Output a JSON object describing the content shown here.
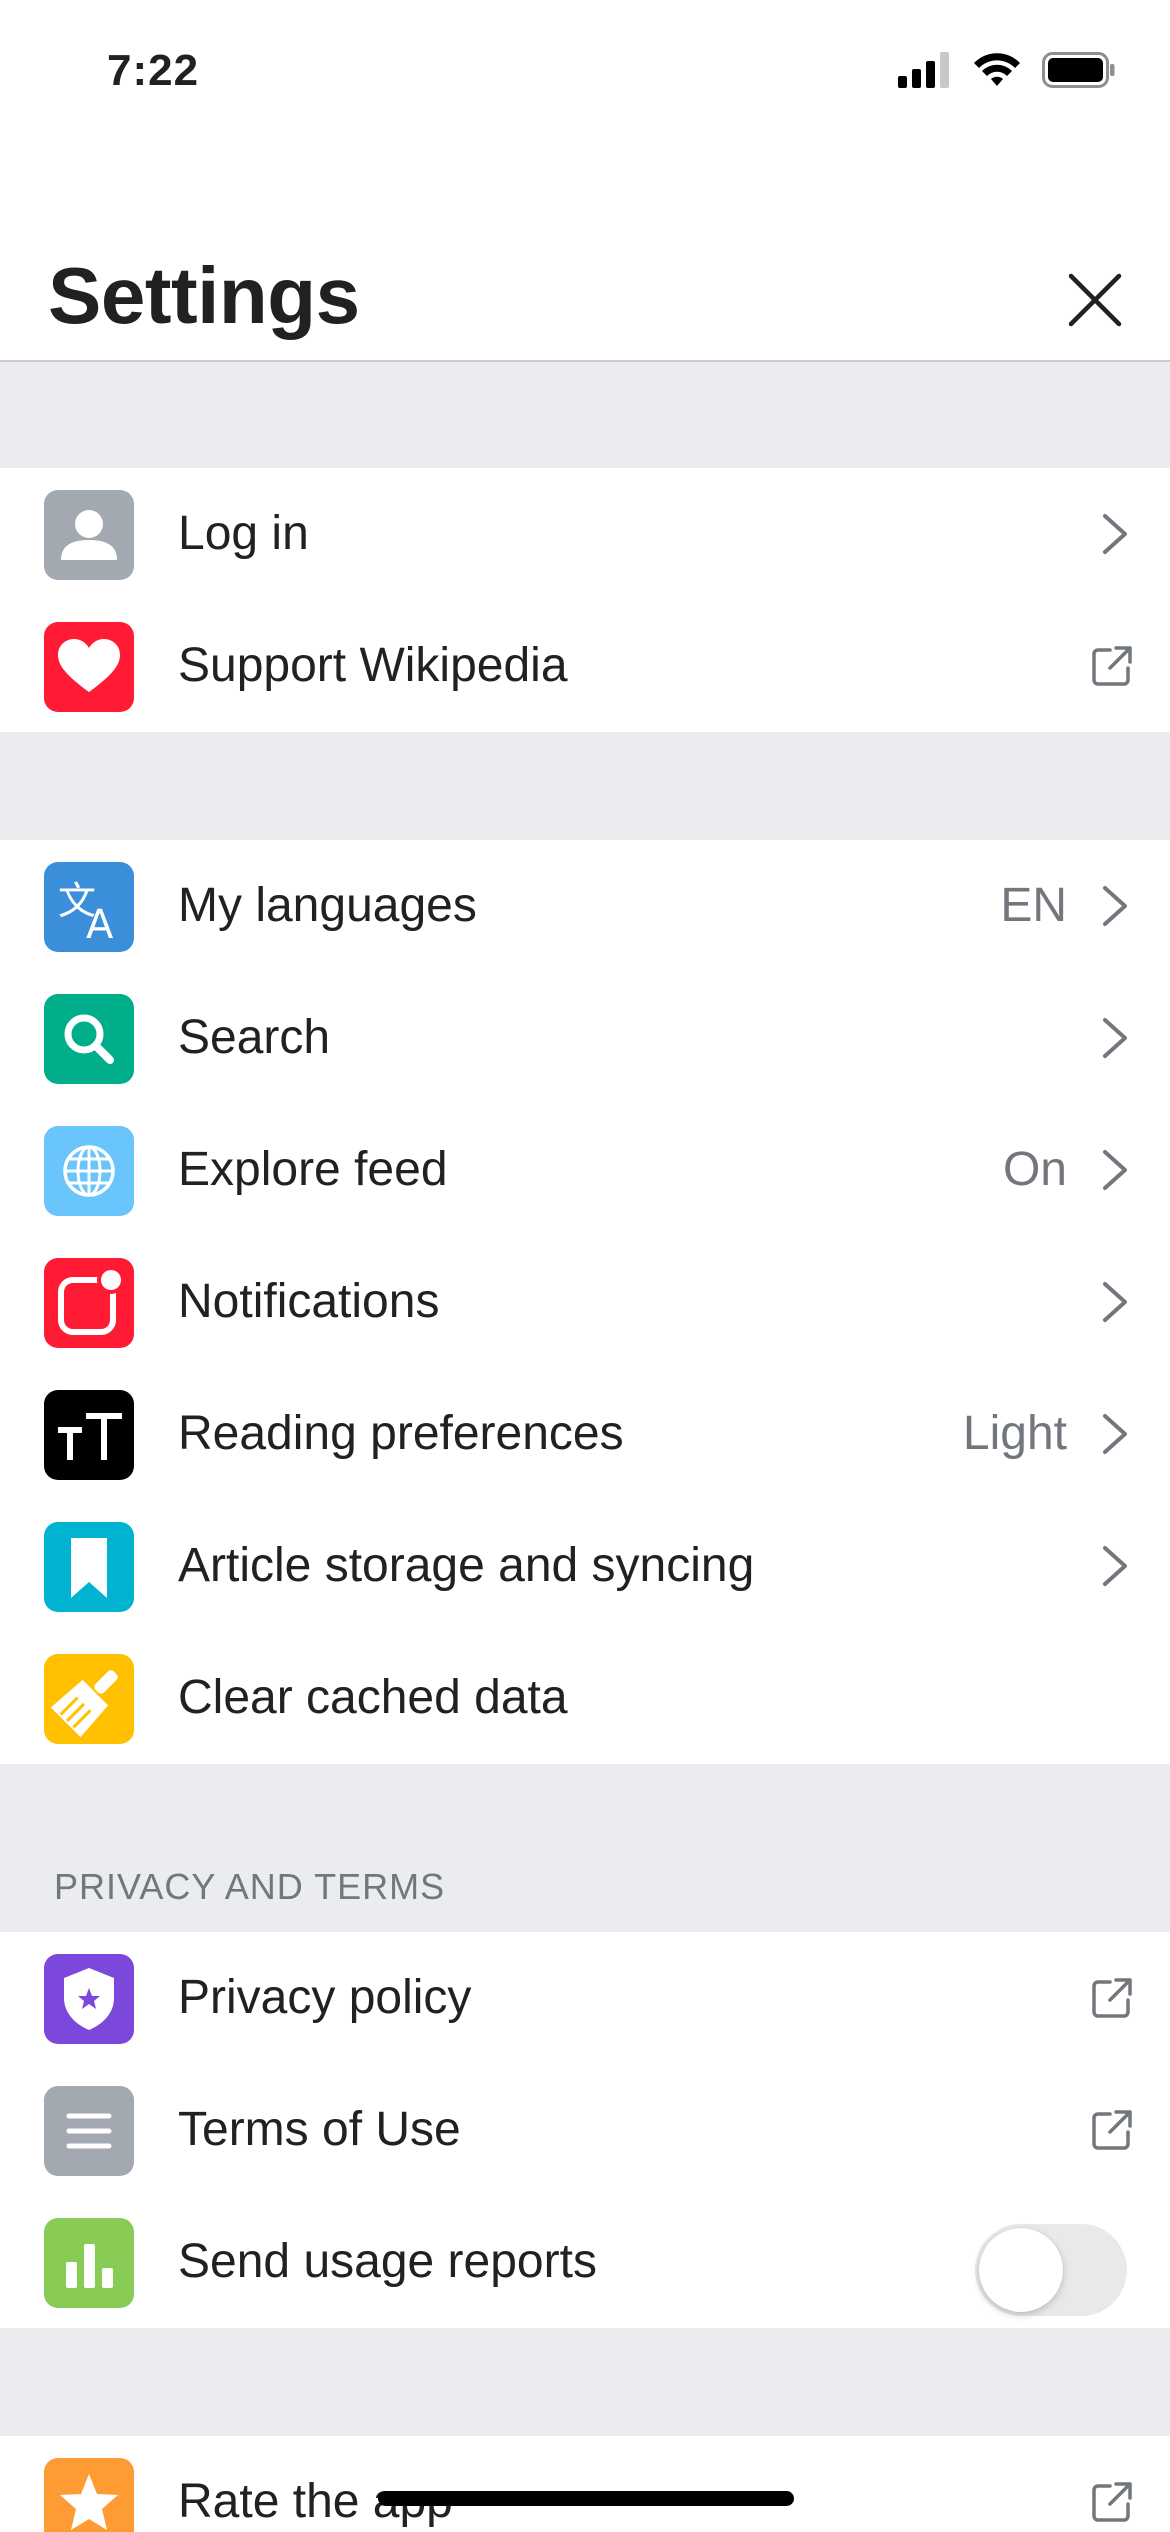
{
  "status_bar": {
    "time": "7:22"
  },
  "header": {
    "title": "Settings"
  },
  "account_group": [
    {
      "label": "Log in",
      "icon": "user-icon",
      "color": "#a2a9b1",
      "accessory": "chevron"
    },
    {
      "label": "Support Wikipedia",
      "icon": "heart-icon",
      "color": "#ff1b33",
      "accessory": "external"
    }
  ],
  "main_group": [
    {
      "label": "My languages",
      "value": "EN",
      "icon": "translate-icon",
      "color": "#3a8eda",
      "accessory": "chevron"
    },
    {
      "label": "Search",
      "value": "",
      "icon": "search-icon",
      "color": "#00af89",
      "accessory": "chevron"
    },
    {
      "label": "Explore feed",
      "value": "On",
      "icon": "globe-icon",
      "color": "#69c5fb",
      "accessory": "chevron"
    },
    {
      "label": "Notifications",
      "value": "",
      "icon": "notification-icon",
      "color": "#ff1b33",
      "accessory": "chevron"
    },
    {
      "label": "Reading preferences",
      "value": "Light",
      "icon": "text-size-icon",
      "color": "#000000",
      "accessory": "chevron"
    },
    {
      "label": "Article storage and syncing",
      "value": "",
      "icon": "bookmark-icon",
      "color": "#00b3d1",
      "accessory": "chevron"
    },
    {
      "label": "Clear cached data",
      "value": "",
      "icon": "broom-icon",
      "color": "#ffc000",
      "accessory": "none"
    }
  ],
  "privacy_section": {
    "header": "PRIVACY AND TERMS",
    "items": [
      {
        "label": "Privacy policy",
        "icon": "shield-icon",
        "color": "#7b48db",
        "accessory": "external"
      },
      {
        "label": "Terms of Use",
        "icon": "document-lines-icon",
        "color": "#a2a9b1",
        "accessory": "external"
      },
      {
        "label": "Send usage reports",
        "icon": "bar-chart-icon",
        "color": "#88cc55",
        "accessory": "toggle",
        "toggle_on": false
      }
    ]
  },
  "feedback_group": [
    {
      "label": "Rate the app",
      "icon": "star-icon",
      "color": "#ff9b33",
      "accessory": "external"
    }
  ]
}
